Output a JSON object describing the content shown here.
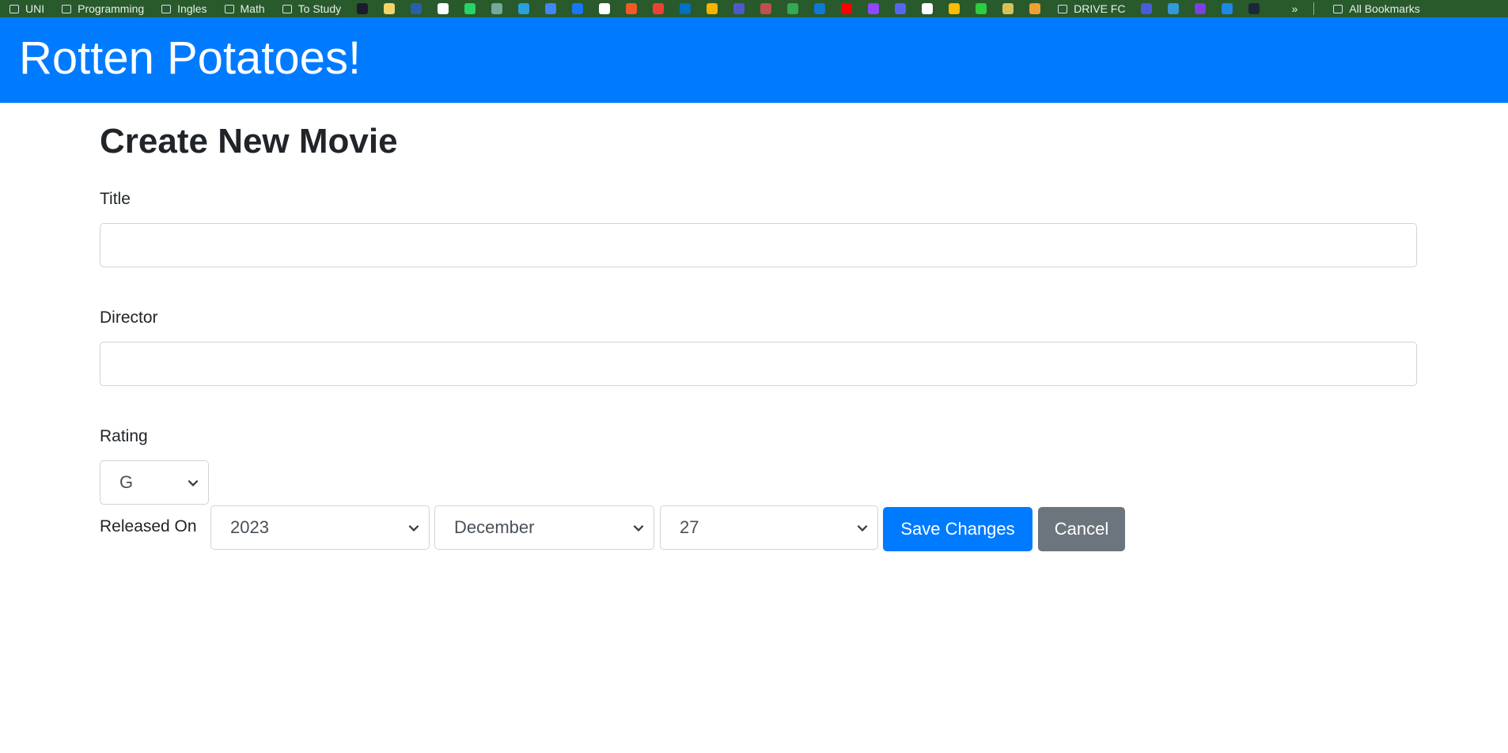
{
  "bookmarks": {
    "folders_left": [
      "UNI",
      "Programming",
      "Ingles",
      "Math",
      "To Study"
    ],
    "icon_colors_a": [
      "#1b1b2f",
      "#f3d36b",
      "#2a5fa8",
      "#ffffff",
      "#25d366",
      "#74aa9c",
      "#2aa1da",
      "#4285f4",
      "#1877f2",
      "#ffffff",
      "#f05a28",
      "#ea4335",
      "#0072c6",
      "#f4b400",
      "#5059c9",
      "#c0504d",
      "#34a853",
      "#0f78d4",
      "#ff0000",
      "#9146ff",
      "#5865f2",
      "#ffffff",
      "#fbbc04",
      "#2ecc40",
      "#d4c25a",
      "#f0a030"
    ],
    "folder_mid": "DRIVE FC",
    "icon_colors_b": [
      "#4a5bd8",
      "#3498db",
      "#7b3fe4",
      "#1e88e5",
      "#1b2838"
    ],
    "overflow": "»",
    "all": "All Bookmarks"
  },
  "header": {
    "title": "Rotten Potatoes!"
  },
  "page": {
    "title": "Create New Movie"
  },
  "form": {
    "title_label": "Title",
    "title_value": "",
    "director_label": "Director",
    "director_value": "",
    "rating_label": "Rating",
    "rating_value": "G",
    "released_label": "Released On",
    "year": "2023",
    "month": "December",
    "day": "27",
    "save": "Save Changes",
    "cancel": "Cancel"
  },
  "colors": {
    "primary": "#007bff",
    "secondary": "#6c757d",
    "bookmark_bar": "#285a2c"
  }
}
